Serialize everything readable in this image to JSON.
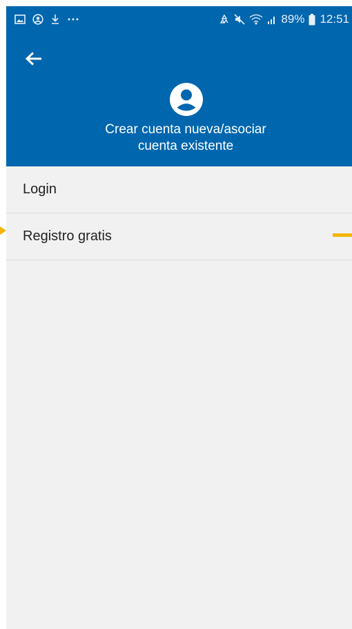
{
  "status_bar": {
    "left_icons": [
      "image-icon",
      "account-circle-icon",
      "download-icon",
      "more-dots-icon"
    ],
    "right_icons": [
      "recycle-icon",
      "mute-icon",
      "wifi-icon",
      "signal-icon",
      "battery-icon"
    ],
    "battery": "89%",
    "time": "12:51"
  },
  "header": {
    "title_line1": "Crear cuenta nueva/asociar",
    "title_line2": "cuenta existente",
    "background_color": "#0066ae"
  },
  "menu": {
    "items": [
      {
        "label": "Login"
      },
      {
        "label": "Registro gratis"
      }
    ]
  },
  "colors": {
    "accent_marker": "#f5b400",
    "list_background": "#f1f1f1"
  }
}
